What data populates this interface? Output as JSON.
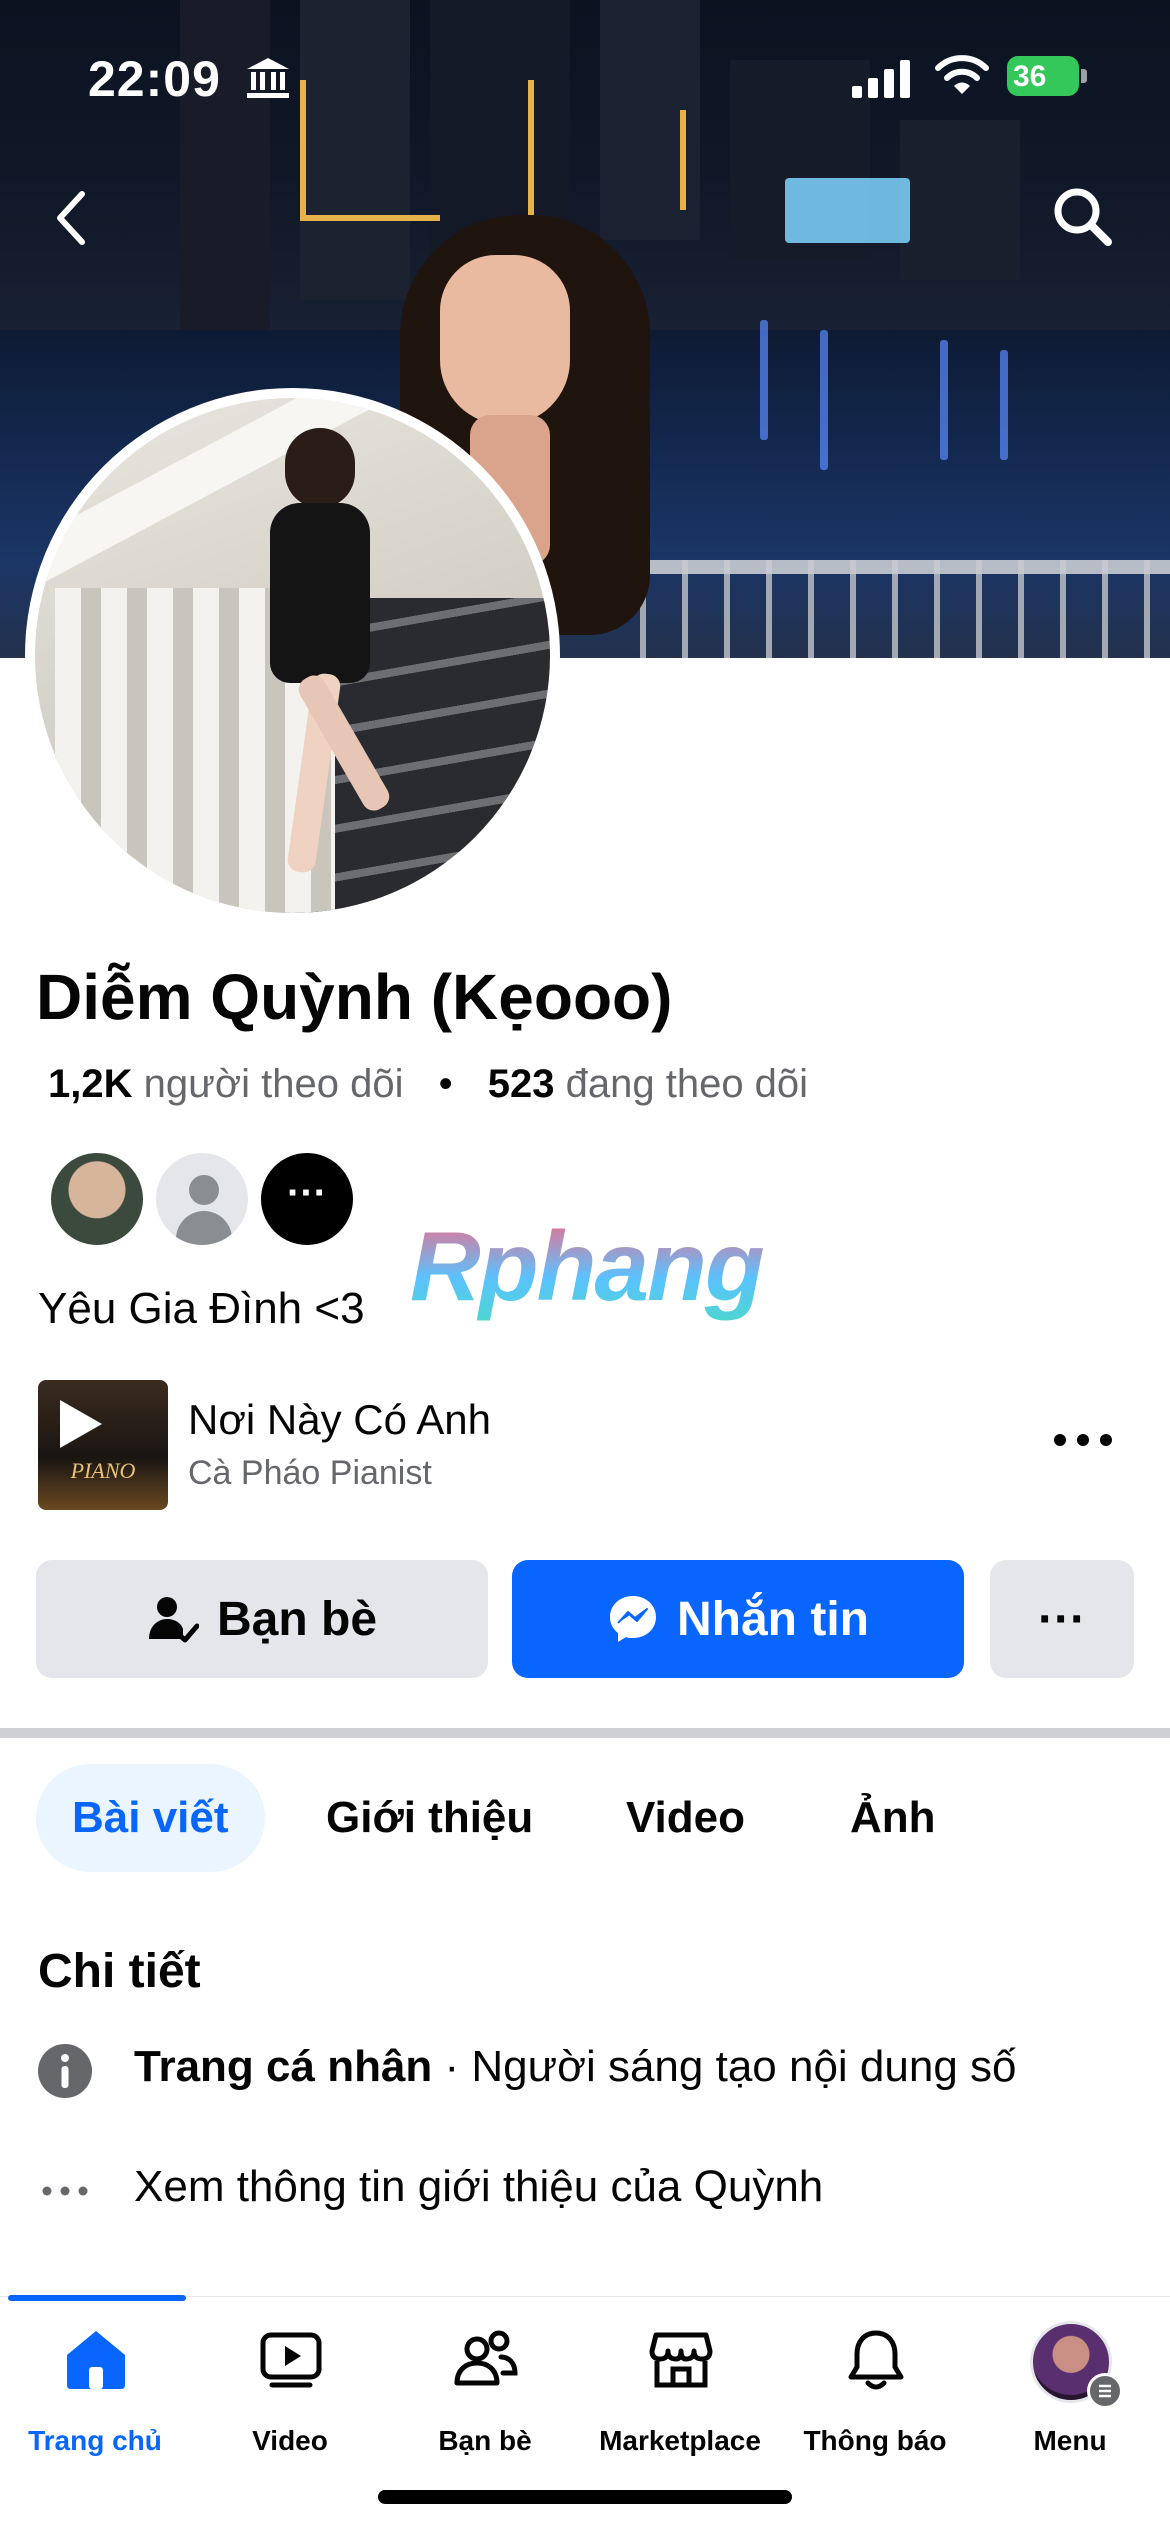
{
  "status_bar": {
    "time": "22:09",
    "battery": "36"
  },
  "profile": {
    "name": "Diễm Quỳnh (Kẹooo)",
    "followers_count": "1,2K",
    "followers_label": "người theo dõi",
    "following_count": "523",
    "following_label": "đang theo dõi",
    "bio": "Yêu Gia Đình <3"
  },
  "watermark": "Rphang",
  "music": {
    "title": "Nơi Này Có Anh",
    "artist": "Cà Pháo Pianist",
    "art_text": "PIANO"
  },
  "actions": {
    "friends_label": "Bạn bè",
    "message_label": "Nhắn tin",
    "more_label": "···"
  },
  "tabs": [
    {
      "label": "Bài viết",
      "active": true
    },
    {
      "label": "Giới thiệu",
      "active": false
    },
    {
      "label": "Video",
      "active": false
    },
    {
      "label": "Ảnh",
      "active": false
    }
  ],
  "details": {
    "title": "Chi tiết",
    "page_type_bold": "Trang cá nhân",
    "page_type_rest": " · Người sáng tạo nội dung số",
    "see_about": "Xem thông tin giới thiệu của Quỳnh"
  },
  "nav": [
    {
      "label": "Trang chủ",
      "icon": "home-icon",
      "active": true
    },
    {
      "label": "Video",
      "icon": "video-icon",
      "active": false
    },
    {
      "label": "Bạn bè",
      "icon": "friends-icon",
      "active": false
    },
    {
      "label": "Marketplace",
      "icon": "marketplace-icon",
      "active": false
    },
    {
      "label": "Thông báo",
      "icon": "bell-icon",
      "active": false
    },
    {
      "label": "Menu",
      "icon": "menu-avatar",
      "active": false
    }
  ],
  "colors": {
    "accent": "#0866ff",
    "secondary_text": "#65676b",
    "button_gray": "#e4e6eb"
  }
}
